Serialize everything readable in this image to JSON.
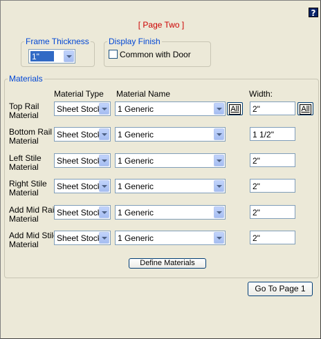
{
  "help": {
    "label": "?"
  },
  "page_label": "[ Page Two ]",
  "frame_thickness": {
    "legend": "Frame Thickness",
    "value": "1\""
  },
  "display_finish": {
    "legend": "Display Finish",
    "checkbox_label": "Common with Door",
    "checked": false
  },
  "materials": {
    "legend": "Materials",
    "headers": {
      "type": "Material Type",
      "name": "Material Name",
      "width": "Width:"
    },
    "rows": [
      {
        "label_1": "Top Rail",
        "label_2": "Material",
        "type": "Sheet Stock",
        "name": "1 Generic",
        "width": "2\""
      },
      {
        "label_1": "Bottom Rail",
        "label_2": "Material",
        "type": "Sheet Stock",
        "name": "1 Generic",
        "width": "1 1/2\""
      },
      {
        "label_1": "Left Stile",
        "label_2": "Material",
        "type": "Sheet Stock",
        "name": "1 Generic",
        "width": "2\""
      },
      {
        "label_1": "Right Stile",
        "label_2": "Material",
        "type": "Sheet Stock",
        "name": "1 Generic",
        "width": "2\""
      },
      {
        "label_1": "Add Mid Rail",
        "label_2": "Material",
        "type": "Sheet Stock",
        "name": "1 Generic",
        "width": "2\""
      },
      {
        "label_1": "Add Mid Stile",
        "label_2": "Material",
        "type": "Sheet Stock",
        "name": "1 Generic",
        "width": "2\""
      }
    ],
    "all_label": "All",
    "define_button": "Define Materials"
  },
  "go_button": "Go To Page 1"
}
